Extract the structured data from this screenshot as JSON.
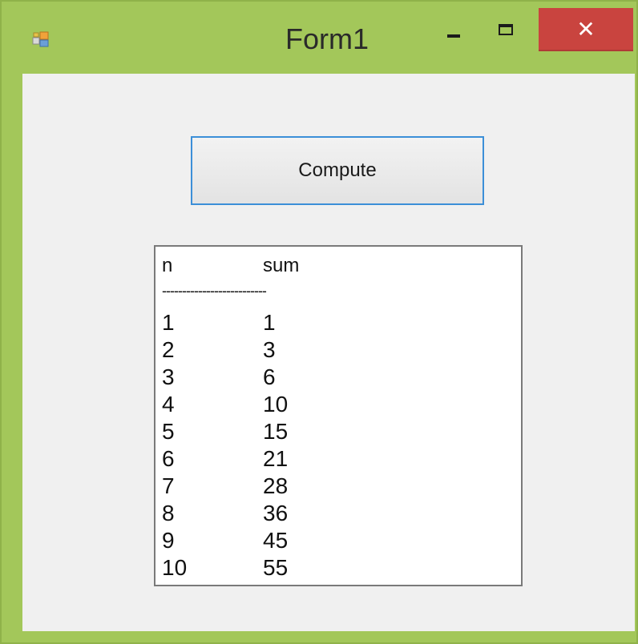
{
  "window": {
    "title": "Form1",
    "icon": "app-form-icon",
    "controls": {
      "minimize_icon": "minimize-icon",
      "maximize_icon": "maximize-icon",
      "close_label": "✕"
    },
    "frame_color": "#a3c75a",
    "close_color": "#c9443f"
  },
  "form": {
    "compute_button_label": "Compute",
    "list": {
      "header": {
        "n": "n",
        "sum": "sum"
      },
      "separator": "--------------------------",
      "rows": [
        {
          "n": "1",
          "sum": "1"
        },
        {
          "n": "2",
          "sum": "3"
        },
        {
          "n": "3",
          "sum": "6"
        },
        {
          "n": "4",
          "sum": "10"
        },
        {
          "n": "5",
          "sum": "15"
        },
        {
          "n": "6",
          "sum": "21"
        },
        {
          "n": "7",
          "sum": "28"
        },
        {
          "n": "8",
          "sum": "36"
        },
        {
          "n": "9",
          "sum": "45"
        },
        {
          "n": "10",
          "sum": "55"
        }
      ]
    }
  }
}
